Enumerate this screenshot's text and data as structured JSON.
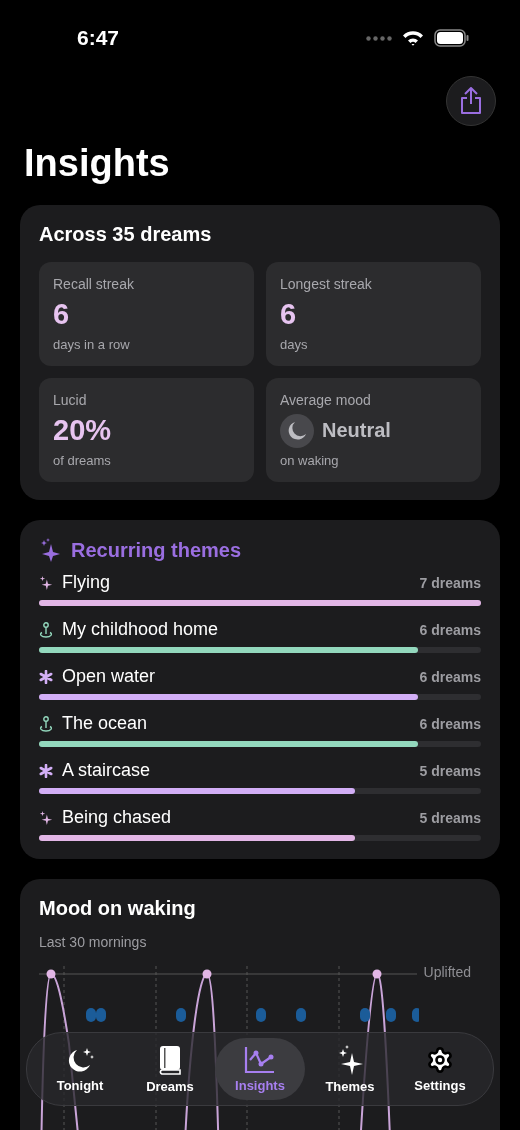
{
  "status_bar": {
    "time": "6:47"
  },
  "title": "Insights",
  "summary": {
    "heading": "Across 35 dreams",
    "stats": [
      {
        "kind": "number",
        "label": "Recall streak",
        "value": "6",
        "caption": "days in a row"
      },
      {
        "kind": "number",
        "label": "Longest streak",
        "value": "6",
        "caption": "days"
      },
      {
        "kind": "number",
        "label": "Lucid",
        "value": "20%",
        "caption": "of dreams"
      },
      {
        "kind": "mood",
        "label": "Average mood",
        "value": "Neutral",
        "caption": "on waking"
      }
    ]
  },
  "themes": {
    "heading": "Recurring themes",
    "items": [
      {
        "kind": "sparkle",
        "name": "Flying",
        "count": "7 dreams",
        "level": 1,
        "color": "#e2b6e6"
      },
      {
        "kind": "pin",
        "name": "My childhood home",
        "count": "6 dreams",
        "level": 0.857,
        "color": "#93d8bd"
      },
      {
        "kind": "asterisk",
        "name": "Open water",
        "count": "6 dreams",
        "level": 0.857,
        "color": "#d2aef6"
      },
      {
        "kind": "pin",
        "name": "The ocean",
        "count": "6 dreams",
        "level": 0.857,
        "color": "#93d8bd"
      },
      {
        "kind": "asterisk",
        "name": "A staircase",
        "count": "5 dreams",
        "level": 0.714,
        "color": "#d2aef6"
      },
      {
        "kind": "sparkle",
        "name": "Being chased",
        "count": "5 dreams",
        "level": 0.714,
        "color": "#e2b6e6"
      }
    ]
  },
  "mood": {
    "heading": "Mood on waking",
    "subtitle": "Last 30 mornings",
    "top_label": "Uplifted"
  },
  "tabs": [
    {
      "kind": "moon",
      "label": "Tonight",
      "selected": false
    },
    {
      "kind": "book",
      "label": "Dreams",
      "selected": false
    },
    {
      "kind": "chart",
      "label": "Insights",
      "selected": true
    },
    {
      "kind": "sparkles",
      "label": "Themes",
      "selected": false
    },
    {
      "kind": "gear",
      "label": "Settings",
      "selected": false
    }
  ]
}
